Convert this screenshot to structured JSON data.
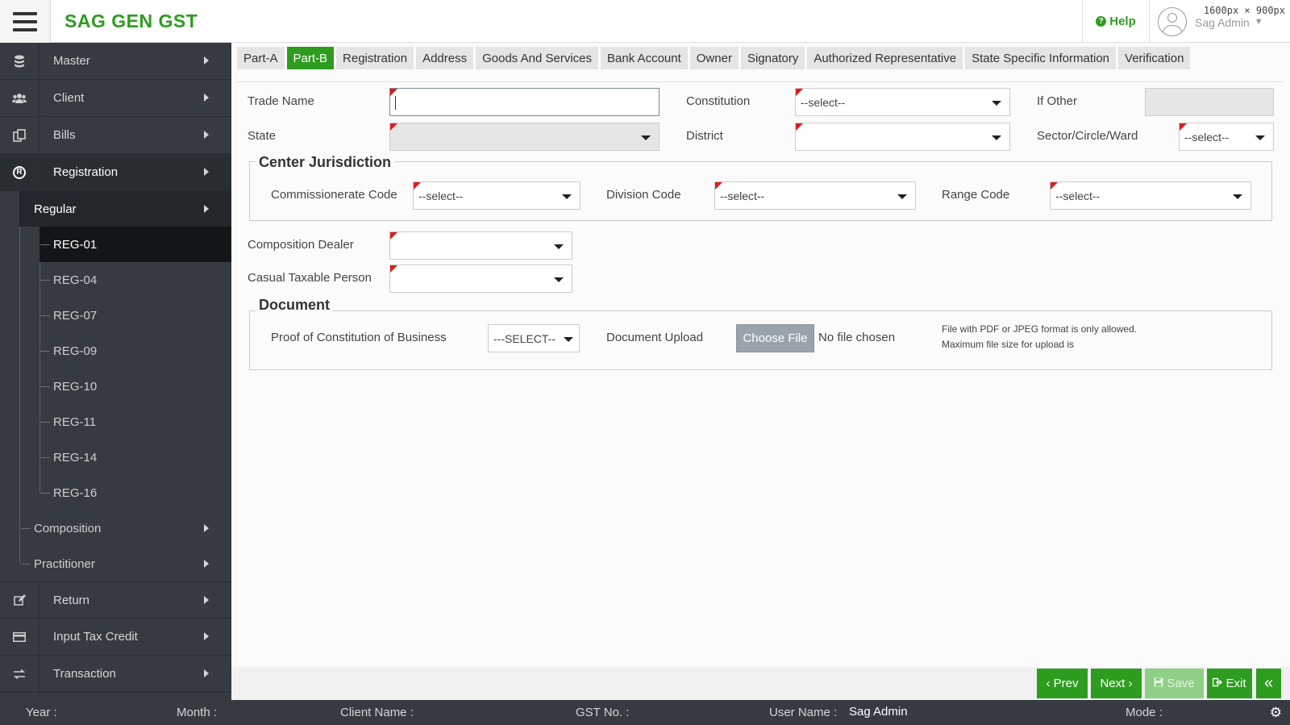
{
  "header": {
    "brand": "SAG GEN GST",
    "help_label": "Help",
    "user_name": "Sag Admin",
    "screen_label": "1600px × 900px"
  },
  "sidebar": {
    "items": [
      {
        "label": "Master",
        "icon": "database-icon"
      },
      {
        "label": "Client",
        "icon": "users-icon"
      },
      {
        "label": "Bills",
        "icon": "copy-icon"
      },
      {
        "label": "Registration",
        "icon": "registered-icon"
      }
    ],
    "registration_sub": {
      "regular": "Regular",
      "leaves": [
        "REG-01",
        "REG-04",
        "REG-07",
        "REG-09",
        "REG-10",
        "REG-11",
        "REG-14",
        "REG-16"
      ],
      "composition": "Composition",
      "practitioner": "Practitioner"
    },
    "bottom_items": [
      {
        "label": "Return",
        "icon": "edit-icon"
      },
      {
        "label": "Input Tax Credit",
        "icon": "credit-card-icon"
      },
      {
        "label": "Transaction",
        "icon": "exchange-icon"
      }
    ]
  },
  "tabs": [
    "Part-A",
    "Part-B",
    "Registration",
    "Address",
    "Goods And Services",
    "Bank Account",
    "Owner",
    "Signatory",
    "Authorized Representative",
    "State Specific Information",
    "Verification"
  ],
  "active_tab": "Part-B",
  "form": {
    "trade_name_label": "Trade Name",
    "trade_name_value": "",
    "constitution_label": "Constitution",
    "constitution_value": "--select--",
    "if_other_label": "If Other",
    "state_label": "State",
    "district_label": "District",
    "sector_label": "Sector/Circle/Ward",
    "sector_value": "--select--",
    "center_legend": "Center Jurisdiction",
    "commissionerate_label": "Commissionerate Code",
    "commissionerate_value": "--select--",
    "division_label": "Division Code",
    "division_value": "--select--",
    "range_label": "Range Code",
    "range_value": "--select--",
    "composition_label": "Composition Dealer",
    "casual_label": "Casual Taxable Person",
    "document_legend": "Document",
    "proof_label": "Proof of Constitution of Business",
    "proof_value": "---SELECT--",
    "upload_label": "Document Upload",
    "choose_file": "Choose File",
    "no_file": "No file chosen",
    "note_line1": "File with PDF or JPEG format is only allowed.",
    "note_line2": "Maximum file size for upload is"
  },
  "buttons": {
    "prev": "‹ Prev",
    "next": "Next ›",
    "save": "Save",
    "exit": "Exit",
    "collapse": "«"
  },
  "statusbar": {
    "year_label": "Year :",
    "month_label": "Month :",
    "client_label": "Client Name :",
    "gst_label": "GST No. :",
    "user_label": "User Name :",
    "user_value": "Sag Admin",
    "mode_label": "Mode :"
  },
  "colors": {
    "brand_green": "#2e9c1f",
    "sidebar_bg": "#353b40",
    "required_marker": "#e01b1b"
  }
}
